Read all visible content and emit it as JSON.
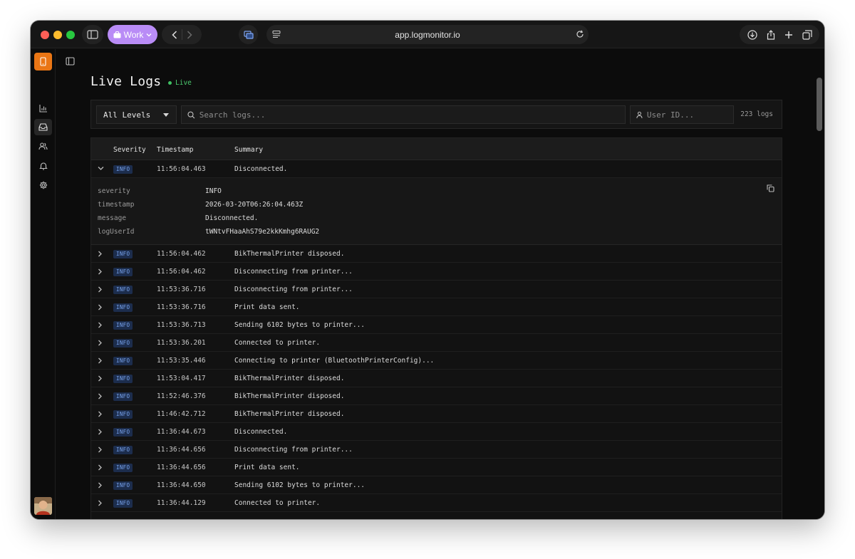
{
  "browser": {
    "profile_label": "Work",
    "url": "app.logmonitor.io"
  },
  "rail": {
    "items": [
      {
        "name": "analytics-icon",
        "active": false
      },
      {
        "name": "inbox-icon",
        "active": true
      },
      {
        "name": "users-icon",
        "active": false
      },
      {
        "name": "bell-icon",
        "active": false
      },
      {
        "name": "gear-icon",
        "active": false
      }
    ]
  },
  "page": {
    "title": "Live Logs",
    "live_label": "Live"
  },
  "filters": {
    "level_value": "All Levels",
    "search_placeholder": "Search logs...",
    "user_placeholder": "User ID...",
    "count_label": "223 logs"
  },
  "table": {
    "columns": {
      "severity": "Severity",
      "timestamp": "Timestamp",
      "summary": "Summary"
    },
    "expanded": {
      "severity": "INFO",
      "timestamp": "11:56:04.463",
      "summary": "Disconnected.",
      "fields": [
        {
          "key": "severity",
          "value": "INFO"
        },
        {
          "key": "timestamp",
          "value": "2026-03-20T06:26:04.463Z"
        },
        {
          "key": "message",
          "value": "Disconnected."
        },
        {
          "key": "logUserId",
          "value": "tWNtvFHaaAhS79e2kkKmhg6RAUG2"
        }
      ]
    },
    "rows": [
      {
        "severity": "INFO",
        "timestamp": "11:56:04.462",
        "summary": "BikThermalPrinter disposed."
      },
      {
        "severity": "INFO",
        "timestamp": "11:56:04.462",
        "summary": "Disconnecting from printer..."
      },
      {
        "severity": "INFO",
        "timestamp": "11:53:36.716",
        "summary": "Disconnecting from printer..."
      },
      {
        "severity": "INFO",
        "timestamp": "11:53:36.716",
        "summary": "Print data sent."
      },
      {
        "severity": "INFO",
        "timestamp": "11:53:36.713",
        "summary": "Sending 6102 bytes to printer..."
      },
      {
        "severity": "INFO",
        "timestamp": "11:53:36.201",
        "summary": "Connected to printer."
      },
      {
        "severity": "INFO",
        "timestamp": "11:53:35.446",
        "summary": "Connecting to printer (BluetoothPrinterConfig)..."
      },
      {
        "severity": "INFO",
        "timestamp": "11:53:04.417",
        "summary": "BikThermalPrinter disposed."
      },
      {
        "severity": "INFO",
        "timestamp": "11:52:46.376",
        "summary": "BikThermalPrinter disposed."
      },
      {
        "severity": "INFO",
        "timestamp": "11:46:42.712",
        "summary": "BikThermalPrinter disposed."
      },
      {
        "severity": "INFO",
        "timestamp": "11:36:44.673",
        "summary": "Disconnected."
      },
      {
        "severity": "INFO",
        "timestamp": "11:36:44.656",
        "summary": "Disconnecting from printer..."
      },
      {
        "severity": "INFO",
        "timestamp": "11:36:44.656",
        "summary": "Print data sent."
      },
      {
        "severity": "INFO",
        "timestamp": "11:36:44.650",
        "summary": "Sending 6102 bytes to printer..."
      },
      {
        "severity": "INFO",
        "timestamp": "11:36:44.129",
        "summary": "Connected to printer."
      }
    ]
  },
  "colors": {
    "accent": "#ea7615",
    "live": "#4ccb6f",
    "badge_bg": "#1c2d4d",
    "badge_text": "#7aa6f0",
    "profile": "#b98cf6"
  }
}
